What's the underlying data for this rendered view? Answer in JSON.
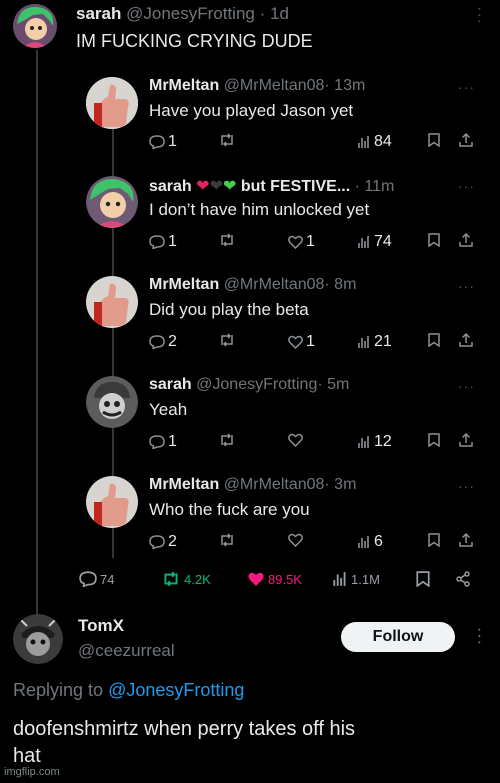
{
  "main_tweet": {
    "author": "sarah",
    "handle": "@JonesyFrotting",
    "time": "· 1d",
    "text": "IM FUCKING CRYING DUDE"
  },
  "quoted": [
    {
      "author": "MrMeltan",
      "handle": "@MrMeltan08",
      "time": "· 13m",
      "text": "Have you played Jason yet",
      "replies": "1",
      "likes": "",
      "views": "84",
      "avatar": "thumbs-up"
    },
    {
      "author": "sarah",
      "handle": "",
      "time": "· 11m",
      "display_suffix": "but FESTIVE...",
      "text": "I don’t have him unlocked yet",
      "replies": "1",
      "likes": "1",
      "views": "74",
      "avatar": "green-hair"
    },
    {
      "author": "MrMeltan",
      "handle": "@MrMeltan08",
      "time": "· 8m",
      "text": "Did you play the beta",
      "replies": "2",
      "likes": "1",
      "views": "21",
      "avatar": "thumbs-up"
    },
    {
      "author": "sarah",
      "handle": "@JonesyFrotting",
      "time": "· 5m",
      "text": "Yeah",
      "replies": "1",
      "likes": "",
      "views": "12",
      "avatar": "grayscale-character"
    },
    {
      "author": "MrMeltan",
      "handle": "@MrMeltan08",
      "time": "· 3m",
      "text": "Who the fuck are you",
      "replies": "2",
      "likes": "",
      "views": "6",
      "avatar": "thumbs-up"
    }
  ],
  "main_stats": {
    "replies": "74",
    "retweets": "4.2K",
    "likes": "89.5K",
    "views": "1.1M",
    "retweet_color": "#00ba7c",
    "like_color": "#f91880"
  },
  "reply": {
    "author": "TomX",
    "handle": "@ceezurreal",
    "follow_label": "Follow",
    "replying_prefix": "Replying to ",
    "replying_handle": "@JonesyFrotting",
    "text_line1": "doofenshmirtz when perry takes off his",
    "text_line2": "hat",
    "link_color": "#1d9bf0"
  },
  "watermark": "imgflip.com"
}
